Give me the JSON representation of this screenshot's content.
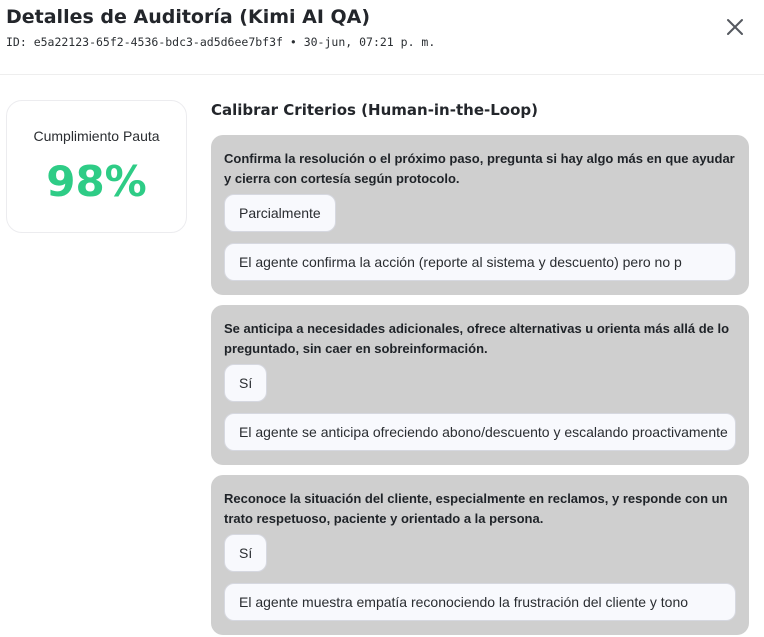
{
  "header": {
    "title": "Detalles de Auditoría (Kimi AI QA)",
    "subtitle": "ID: e5a22123-65f2-4536-bdc3-ad5d6ee7bf3f • 30-jun, 07:21 p. m.",
    "close_icon": "close-icon"
  },
  "score": {
    "label": "Cumplimiento Pauta",
    "value": "98%",
    "color": "#2ecc86"
  },
  "calibration": {
    "title": "Calibrar Criterios (Human-in-the-Loop)",
    "criteria": [
      {
        "text": "Confirma la resolución o el próximo paso, pregunta si hay algo más en que ayudar y cierra con cortesía según protocolo.",
        "verdict": "Parcialmente",
        "justification": "El agente confirma la acción (reporte al sistema y descuento) pero no p"
      },
      {
        "text": "Se anticipa a necesidades adicionales, ofrece alternativas u orienta más allá de lo preguntado, sin caer en sobreinformación.",
        "verdict": "Sí",
        "justification": "El agente se anticipa ofreciendo abono/descuento y escalando proactivamente"
      },
      {
        "text": "Reconoce la situación del cliente, especialmente en reclamos, y responde con un trato respetuoso, paciente y orientado a la persona.",
        "verdict": "Sí",
        "justification": "El agente muestra empatía reconociendo la frustración del cliente y tono"
      }
    ]
  }
}
